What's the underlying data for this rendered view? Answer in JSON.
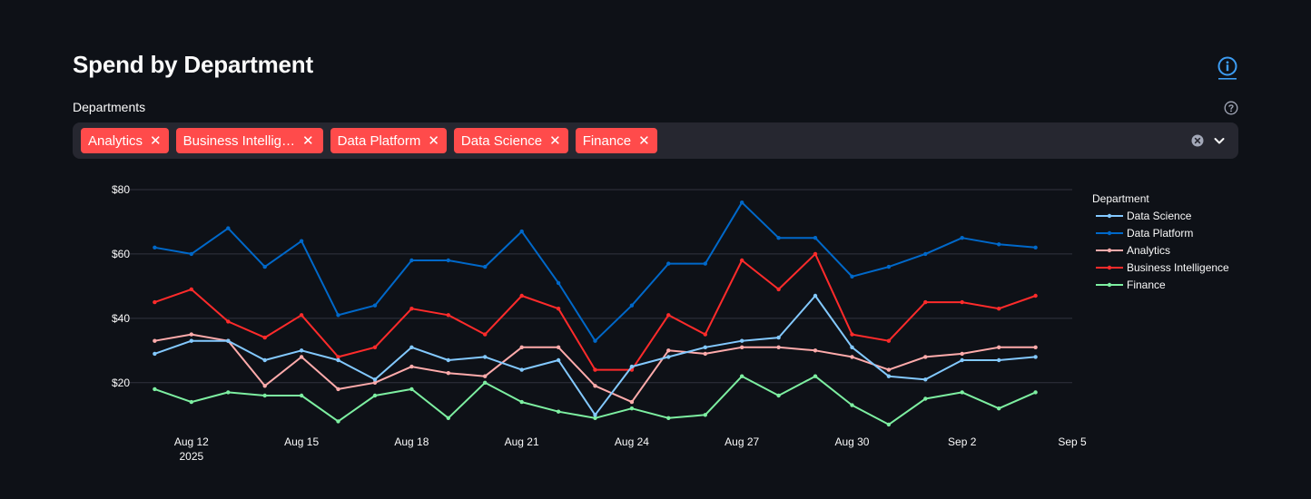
{
  "header": {
    "title": "Spend by Department"
  },
  "filter": {
    "label": "Departments",
    "selected": [
      {
        "label": "Analytics"
      },
      {
        "label": "Business Intellig…"
      },
      {
        "label": "Data Platform"
      },
      {
        "label": "Data Science"
      },
      {
        "label": "Finance"
      }
    ],
    "tag_color": "#ff4b4b"
  },
  "icons": {
    "info": "info-circle-icon",
    "help": "question-circle-icon",
    "clear": "clear-x-icon",
    "dropdown": "chevron-down-icon"
  },
  "chart_data": {
    "type": "line",
    "title": "",
    "xlabel": "",
    "ylabel": "",
    "x": [
      "2025-08-11",
      "2025-08-12",
      "2025-08-13",
      "2025-08-14",
      "2025-08-15",
      "2025-08-16",
      "2025-08-17",
      "2025-08-18",
      "2025-08-19",
      "2025-08-20",
      "2025-08-21",
      "2025-08-22",
      "2025-08-23",
      "2025-08-24",
      "2025-08-25",
      "2025-08-26",
      "2025-08-27",
      "2025-08-28",
      "2025-08-29",
      "2025-08-30",
      "2025-08-31",
      "2025-09-01",
      "2025-09-02",
      "2025-09-03",
      "2025-09-04"
    ],
    "x_ticks": [
      {
        "date": "2025-08-12",
        "label": "Aug 12",
        "sub": "2025"
      },
      {
        "date": "2025-08-15",
        "label": "Aug 15",
        "sub": ""
      },
      {
        "date": "2025-08-18",
        "label": "Aug 18",
        "sub": ""
      },
      {
        "date": "2025-08-21",
        "label": "Aug 21",
        "sub": ""
      },
      {
        "date": "2025-08-24",
        "label": "Aug 24",
        "sub": ""
      },
      {
        "date": "2025-08-27",
        "label": "Aug 27",
        "sub": ""
      },
      {
        "date": "2025-08-30",
        "label": "Aug 30",
        "sub": ""
      },
      {
        "date": "2025-09-02",
        "label": "Sep 2",
        "sub": ""
      },
      {
        "date": "2025-09-05",
        "label": "Sep 5",
        "sub": ""
      }
    ],
    "xlim": [
      "2025-08-10",
      "2025-09-05"
    ],
    "ylim": [
      5,
      80
    ],
    "y_ticks": [
      20,
      40,
      60,
      80
    ],
    "y_tick_labels": [
      "$20",
      "$40",
      "$60",
      "$80"
    ],
    "grid": true,
    "legend": {
      "title": "Department",
      "position": "right"
    },
    "series": [
      {
        "name": "Data Science",
        "color": "#83c9ff",
        "values": [
          29,
          33,
          33,
          27,
          30,
          27,
          21,
          31,
          27,
          28,
          24,
          27,
          10,
          25,
          28,
          31,
          33,
          34,
          47,
          31,
          22,
          21,
          27,
          27,
          28
        ]
      },
      {
        "name": "Data Platform",
        "color": "#0068c9",
        "values": [
          62,
          60,
          68,
          56,
          64,
          41,
          44,
          58,
          58,
          56,
          67,
          51,
          33,
          44,
          57,
          57,
          76,
          65,
          65,
          53,
          56,
          60,
          65,
          63,
          62
        ]
      },
      {
        "name": "Analytics",
        "color": "#ffabab",
        "values": [
          33,
          35,
          33,
          19,
          28,
          18,
          20,
          25,
          23,
          22,
          31,
          31,
          19,
          14,
          30,
          29,
          31,
          31,
          30,
          28,
          24,
          28,
          29,
          31,
          31
        ]
      },
      {
        "name": "Business Intelligence",
        "color": "#ff2b2b",
        "values": [
          45,
          49,
          39,
          34,
          41,
          28,
          31,
          43,
          41,
          35,
          47,
          43,
          24,
          24,
          41,
          35,
          58,
          49,
          60,
          35,
          33,
          45,
          45,
          43,
          47
        ]
      },
      {
        "name": "Finance",
        "color": "#7defa1",
        "values": [
          18,
          14,
          17,
          16,
          16,
          8,
          16,
          18,
          9,
          20,
          14,
          11,
          9,
          12,
          9,
          10,
          22,
          16,
          22,
          13,
          7,
          15,
          17,
          12,
          17
        ]
      }
    ]
  }
}
